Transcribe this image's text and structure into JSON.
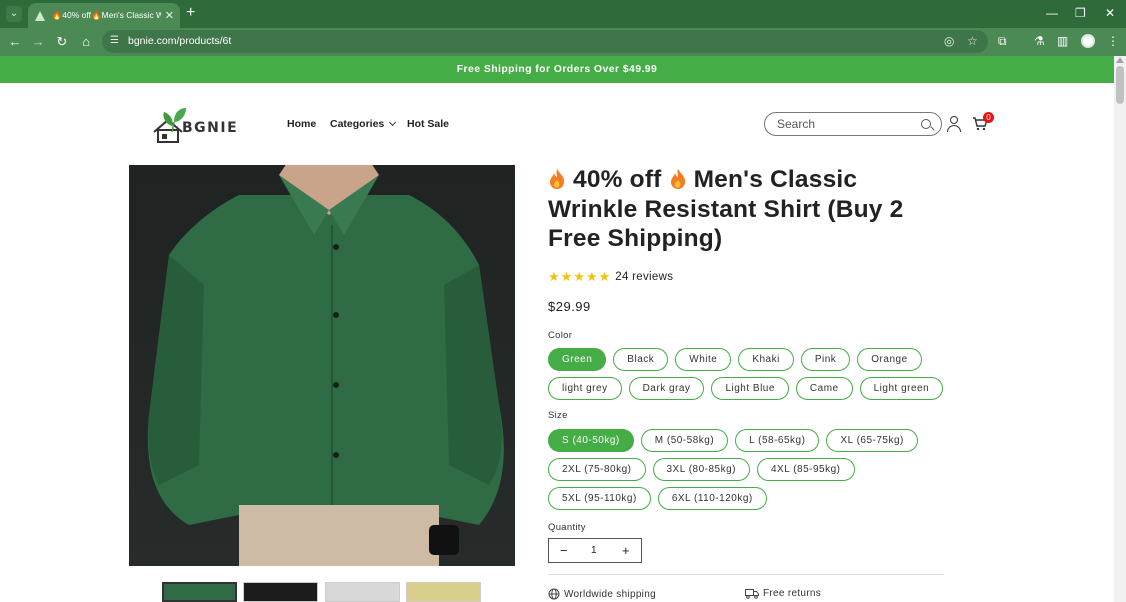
{
  "browser": {
    "tab_title": "🔥40% off🔥Men's Classic Wrin",
    "url": "bgnie.com/products/6t",
    "new_tab": "+",
    "tab_close": "✕",
    "win_min": "—",
    "win_max": "❐",
    "win_close": "✕"
  },
  "announcement": "Free Shipping for Orders Over $49.99",
  "header": {
    "logo_text": "BGNIE",
    "nav": [
      {
        "label": "Home"
      },
      {
        "label": "Categories"
      },
      {
        "label": "Hot Sale"
      }
    ],
    "search_placeholder": "Search",
    "cart_count": "0"
  },
  "product": {
    "title_line1": "40% off",
    "title_line1b": "Men's Classic",
    "title_rest": "Wrinkle Resistant Shirt  (Buy 2 Free Shipping)",
    "rating": 5,
    "reviews": "24 reviews",
    "price": "$29.99",
    "color_label": "Color",
    "colors_row1": [
      "Green",
      "Black",
      "White",
      "Khaki",
      "Pink",
      "Orange"
    ],
    "colors_row2": [
      "light grey",
      "Dark gray",
      "Light Blue",
      "Came",
      "Light green"
    ],
    "size_label": "Size",
    "sizes_row1": [
      "S (40-50kg)",
      "M (50-58kg)",
      "L (58-65kg)",
      "XL (65-75kg)"
    ],
    "sizes_row2": [
      "2XL (75-80kg)",
      "3XL (80-85kg)",
      "4XL (85-95kg)"
    ],
    "sizes_row3": [
      "5XL (95-110kg)",
      "6XL (110-120kg)"
    ],
    "selected_color": "Green",
    "selected_size": "S (40-50kg)",
    "quantity_label": "Quantity",
    "quantity": "1",
    "qty_minus": "−",
    "qty_plus": "+",
    "features": [
      "Worldwide shipping",
      "Free returns"
    ]
  },
  "colors": {
    "brand_green": "#45ad45",
    "shirt_green": "#2f6b45"
  }
}
